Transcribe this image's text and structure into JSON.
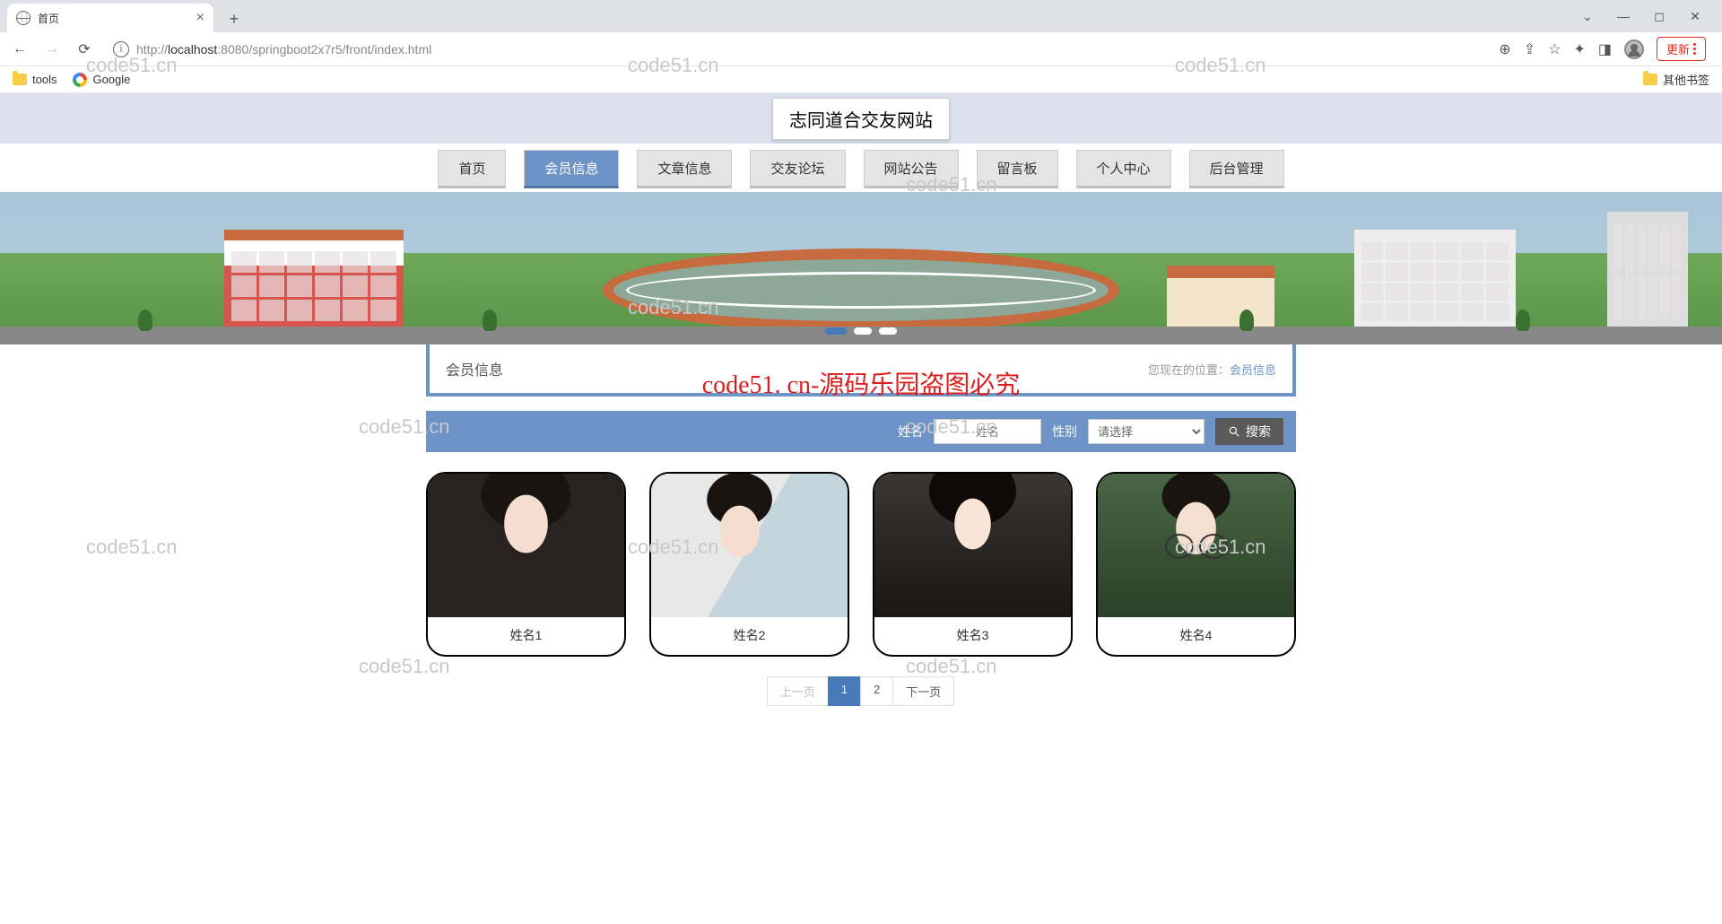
{
  "browser": {
    "tab_title": "首页",
    "url_scheme": "http://",
    "url_host": "localhost",
    "url_port_path": ":8080/springboot2x7r5/front/index.html",
    "update_label": "更新"
  },
  "bookmarks": {
    "tools": "tools",
    "google": "Google",
    "other": "其他书签"
  },
  "site": {
    "title": "志同道合交友网站"
  },
  "nav": [
    {
      "label": "首页",
      "active": false
    },
    {
      "label": "会员信息",
      "active": true
    },
    {
      "label": "文章信息",
      "active": false
    },
    {
      "label": "交友论坛",
      "active": false
    },
    {
      "label": "网站公告",
      "active": false
    },
    {
      "label": "留言板",
      "active": false
    },
    {
      "label": "个人中心",
      "active": false
    },
    {
      "label": "后台管理",
      "active": false
    }
  ],
  "watermark_red": "code51. cn-源码乐园盗图必究",
  "crumb": {
    "title": "会员信息",
    "loc_prefix": "您现在的位置：",
    "loc_link": "会员信息"
  },
  "search": {
    "name_label": "姓名",
    "name_placeholder": "姓名",
    "gender_label": "性别",
    "gender_select": "请选择",
    "button": "搜索"
  },
  "members": [
    {
      "name": "姓名1"
    },
    {
      "name": "姓名2"
    },
    {
      "name": "姓名3"
    },
    {
      "name": "姓名4"
    }
  ],
  "pagination": {
    "prev": "上一页",
    "p1": "1",
    "p2": "2",
    "next": "下一页"
  },
  "wm": "code51.cn"
}
